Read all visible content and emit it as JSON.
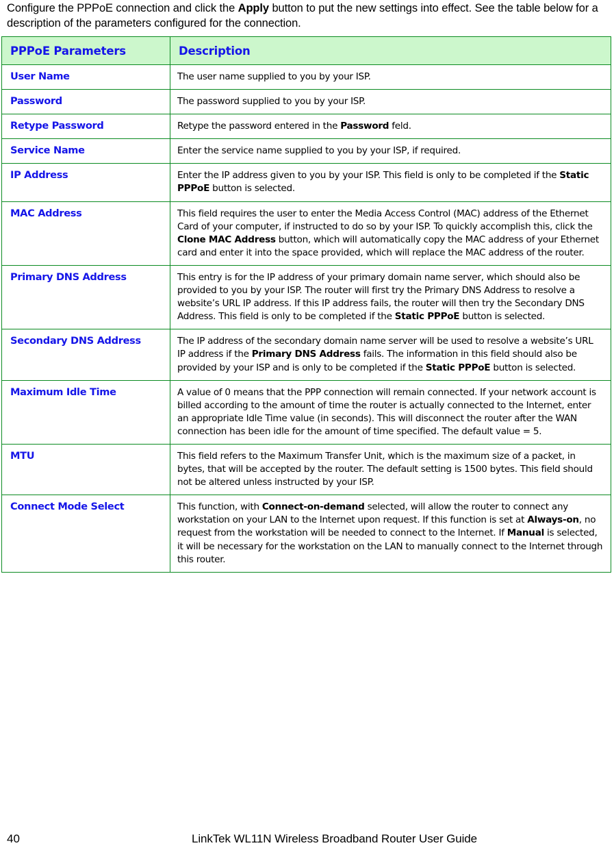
{
  "intro": {
    "line1_pre": "Configure the PPPoE connection and click the ",
    "line1_bold": "Apply",
    "line1_post": " button to put the new settings into effect.",
    "line2": "See the table below for a description of the parameters configured for the connection."
  },
  "table": {
    "headers": {
      "parameter": "PPPoE Parameters",
      "description": "Description"
    },
    "rows": [
      {
        "label": "User Name",
        "description": "The user name supplied to you by your ISP."
      },
      {
        "label": "Password",
        "description": "The password supplied to you by your ISP."
      },
      {
        "label": "Retype Password",
        "description_html": "Retype the password entered in the <b>Password</b> feld.",
        "description": "Retype the password entered in the Password feld."
      },
      {
        "label": "Service Name",
        "description": "Enter the service name supplied to you by your ISP, if required."
      },
      {
        "label": "IP Address",
        "description_html": "Enter the IP address given to you by your ISP. This field is only to be completed if the <b>Static PPPoE</b> button is selected.",
        "description": "Enter the IP address given to you by your ISP. This field is only to be completed if the Static PPPoE button is selected."
      },
      {
        "label": "MAC Address",
        "description_html": "This field requires the user to enter the Media Access Control (MAC) address of the Ethernet Card of your computer, if instructed to do so by your ISP. To quickly accomplish this, click the <b>Clone MAC Address</b> button, which will automatically copy the MAC address of your Ethernet card and enter it into the space provided, which will replace the MAC address of the router.",
        "description": "This field requires the user to enter the Media Access Control (MAC) address of the Ethernet Card of your computer, if instructed to do so by your ISP. To quickly accomplish this, click the Clone MAC Address button, which will automatically copy the MAC address of your Ethernet card and enter it into the space provided, which will replace the MAC address of the router."
      },
      {
        "label": "Primary DNS Address",
        "description_html": "This entry is for the IP address of your primary domain name server, which should also be provided to you by your ISP. The router will first try the Primary DNS Address to resolve a website’s URL IP address. If this IP address fails, the router will then try the Secondary DNS Address. This field is only to be completed if the <b>Static PPPoE</b> button is selected.",
        "description": "This entry is for the IP address of your primary domain name server, which should also be provided to you by your ISP. The router will first try the Primary DNS Address to resolve a website’s URL IP address. If this IP address fails, the router will then try the Secondary DNS Address. This field is only to be completed if the Static PPPoE button is selected."
      },
      {
        "label": "Secondary DNS Address",
        "description_html": "The IP address of the secondary domain name server will be used to resolve a website’s URL IP address if the <b>Primary DNS Address</b> fails. The information in this field should also be provided by your ISP and is only to be completed if the <b>Static PPPoE</b> button is selected.",
        "description": "The IP address of the secondary domain name server will be used to resolve a website’s URL IP address if the Primary DNS Address fails. The information in this field should also be provided by your ISP and is only to be completed if the Static PPPoE button is selected."
      },
      {
        "label": "Maximum Idle Time",
        "description_html": "A value of 0 means that the PPP connection will remain connected. If your network account is billed according to the amount of time the router is actually connected to the Internet, enter an appropriate Idle Time value (in seconds). This will disconnect the router after the WAN connection has been idle for the amount of time specified. The default value = 5.",
        "description": "A value of 0 means that the PPP connection will remain connected. If your network account is billed according to the amount of time the router is actually connected to the Internet, enter an appropriate Idle Time value (in seconds). This will disconnect the router after the WAN connection has been idle for the amount of time specified. The default value = 5."
      },
      {
        "label": "MTU",
        "description_html": "This field refers to the Maximum Transfer Unit, which is the maximum size of a packet, in bytes, that will be accepted by the router. The default setting is 1500 bytes. This field should not be altered unless instructed by your ISP.",
        "description": "This field refers to the Maximum Transfer Unit, which is the maximum size of a packet, in bytes, that will be accepted by the router. The default setting is 1500 bytes. This field should not be altered unless instructed by your ISP."
      },
      {
        "label": "Connect Mode Select",
        "description_html": "This function, with <b>Connect-on-demand</b> selected, will allow the router to connect any workstation on your LAN to the Internet upon request. If this function is set at <b>Always-on</b>, no request from the workstation will be needed to connect to the Internet. If <b>Manual</b> is selected, it will be necessary for the workstation on the LAN to manually connect to the Internet through this router.",
        "description": "This function, with Connect-on-demand selected, will allow the router to connect any workstation on your LAN to the Internet upon request. If this function is set at Always-on, no request from the workstation will be needed to connect to the Internet. If Manual is selected, it will be necessary for the workstation on the LAN to manually connect to the Internet through this router."
      }
    ]
  },
  "footer": {
    "page_number": "40",
    "title": "LinkTek WL11N Wireless Broadband Router User Guide"
  },
  "colors": {
    "header_background": "#ccf7cc",
    "border": "#0a8a20",
    "label_text": "#1515e8",
    "body_text": "#000000"
  }
}
